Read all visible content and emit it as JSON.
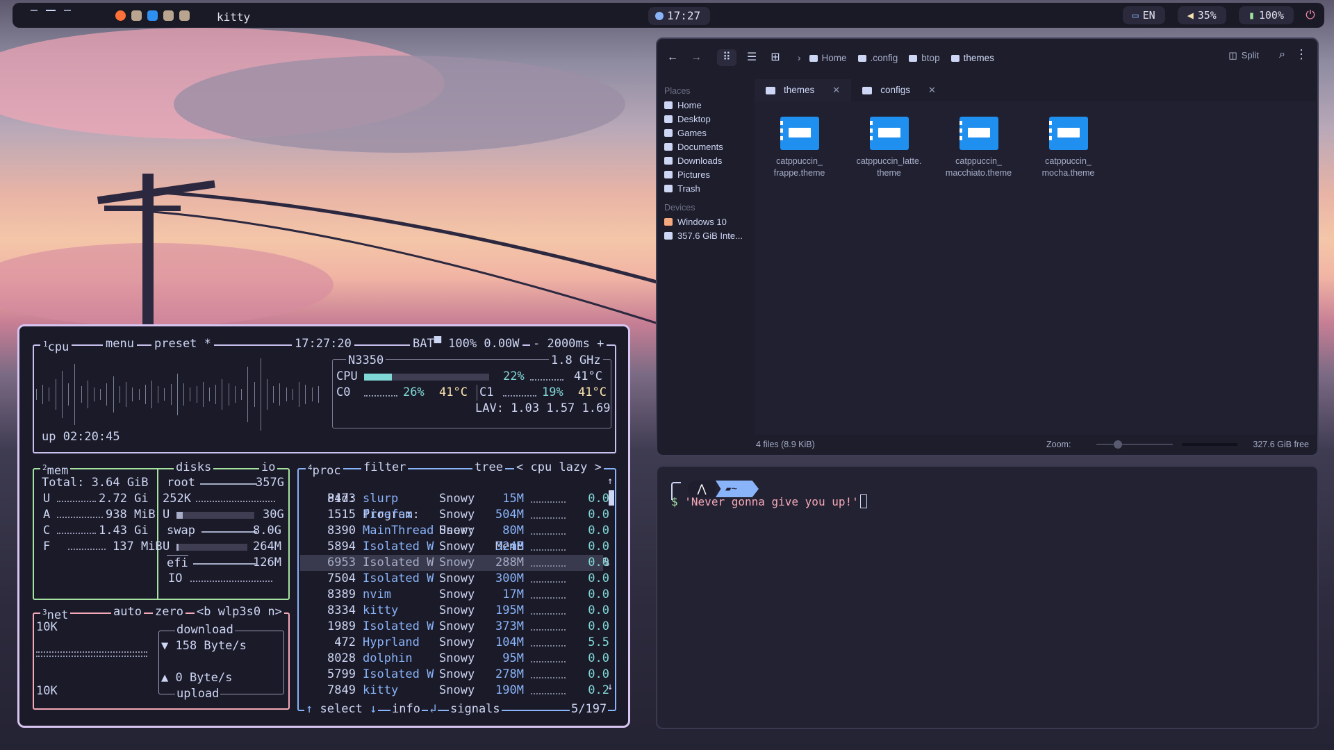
{
  "topbar": {
    "window_title": "kitty",
    "clock": "17:27",
    "language": "EN",
    "volume": "35%",
    "battery": "100%",
    "volume_icon": "speaker-icon",
    "battery_icon": "battery-icon",
    "power_icon": "power-icon"
  },
  "file_manager": {
    "breadcrumb": [
      "Home",
      ".config",
      "btop",
      "themes"
    ],
    "split_label": "Split",
    "places_heading": "Places",
    "places": [
      "Home",
      "Desktop",
      "Games",
      "Documents",
      "Downloads",
      "Pictures",
      "Trash"
    ],
    "devices_heading": "Devices",
    "devices": [
      "Windows 10",
      "357.6 GiB Inte..."
    ],
    "tabs": [
      "themes",
      "configs"
    ],
    "files": [
      {
        "line1": "catppuccin_",
        "line2": "frappe.theme"
      },
      {
        "line1": "catppuccin_latte.",
        "line2": "theme"
      },
      {
        "line1": "catppuccin_",
        "line2": "macchiato.theme"
      },
      {
        "line1": "catppuccin_",
        "line2": "mocha.theme"
      }
    ],
    "status_count": "4 files (8.9 KiB)",
    "zoom_label": "Zoom:",
    "zoom_level": 0.25,
    "free_space": "327.6 GiB free",
    "accent_color": "#1f8ff0"
  },
  "terminal": {
    "prompt_dir": "~",
    "prompt_symbol": "$",
    "command": "'Never gonna give you up!'"
  },
  "btop": {
    "cpu": {
      "header": "cpu",
      "header_num": "1",
      "menu": "menu",
      "preset": "preset *",
      "time": "17:27:20",
      "battery": "BAT▀ 100% 0.00W",
      "interval": "- 2000ms +",
      "model": "N3350",
      "freq": "1.8 GHz",
      "cpu_label": "CPU",
      "cpu_pct": "22%",
      "cpu_pct_value": 22,
      "cpu_temp": "41°C",
      "c0_label": "C0",
      "c0_pct": "26%",
      "c0_temp": "41°C",
      "c1_label": "C1",
      "c1_pct": "19%",
      "c1_temp": "41°C",
      "lav": "LAV: 1.03 1.57 1.69",
      "uptime": "up 02:20:45"
    },
    "mem": {
      "header": "mem",
      "header_num": "2",
      "total": "Total: 3.64 GiB",
      "rows": [
        {
          "k": "U",
          "v": "2.72 Gi"
        },
        {
          "k": "A",
          "v": "938 MiB"
        },
        {
          "k": "C",
          "v": "1.43 Gi"
        },
        {
          "k": "F",
          "v": "137 MiB"
        }
      ]
    },
    "disks": {
      "header": "disks",
      "io_label": "io",
      "root_label": "root",
      "root_size": "357G",
      "root_used": "252K",
      "u_label": "U",
      "root_u": "30G",
      "root_u_fraction": 0.08,
      "swap_label": "swap",
      "swap_size": "8.0G",
      "swap_u": "264M",
      "swap_u_fraction": 0.03,
      "efi_label": "efi",
      "efi_size": "126M",
      "io_row": "IO"
    },
    "net": {
      "header": "net",
      "header_num": "3",
      "auto": "auto",
      "zero": "zero",
      "iface": "<b wlp3s0 n>",
      "scale_top": "10K",
      "scale_bottom": "10K",
      "download_label": "download",
      "download_rate": "▼ 158 Byte/s",
      "upload_rate": "▲ 0 Byte/s",
      "upload_label": "upload"
    },
    "proc": {
      "header": "proc",
      "header_num": "4",
      "filter": "filter",
      "tree": "tree",
      "sort": "< cpu lazy >",
      "columns": {
        "pid": "Pid:",
        "program": "Program:",
        "user": "User:",
        "mem": "MemB",
        "cpu": "Cpu%"
      },
      "rows": [
        {
          "pid": "8473",
          "program": "slurp",
          "user": "Snowy",
          "mem": "15M",
          "cpu": "0.0"
        },
        {
          "pid": "1515",
          "program": "firefox",
          "user": "Snowy",
          "mem": "504M",
          "cpu": "0.0"
        },
        {
          "pid": "8390",
          "program": "MainThread",
          "user": "Snowy",
          "mem": "80M",
          "cpu": "0.0"
        },
        {
          "pid": "5894",
          "program": "Isolated W",
          "user": "Snowy",
          "mem": "324M",
          "cpu": "0.0"
        },
        {
          "pid": "6953",
          "program": "Isolated W",
          "user": "Snowy",
          "mem": "288M",
          "cpu": "0.0"
        },
        {
          "pid": "7504",
          "program": "Isolated W",
          "user": "Snowy",
          "mem": "300M",
          "cpu": "0.0"
        },
        {
          "pid": "8389",
          "program": "nvim",
          "user": "Snowy",
          "mem": "17M",
          "cpu": "0.0"
        },
        {
          "pid": "8334",
          "program": "kitty",
          "user": "Snowy",
          "mem": "195M",
          "cpu": "0.0"
        },
        {
          "pid": "1989",
          "program": "Isolated W",
          "user": "Snowy",
          "mem": "373M",
          "cpu": "0.0"
        },
        {
          "pid": "472",
          "program": "Hyprland",
          "user": "Snowy",
          "mem": "104M",
          "cpu": "5.5"
        },
        {
          "pid": "8028",
          "program": "dolphin",
          "user": "Snowy",
          "mem": "95M",
          "cpu": "0.0"
        },
        {
          "pid": "5799",
          "program": "Isolated W",
          "user": "Snowy",
          "mem": "278M",
          "cpu": "0.0"
        },
        {
          "pid": "7849",
          "program": "kitty",
          "user": "Snowy",
          "mem": "190M",
          "cpu": "0.2"
        }
      ],
      "select": "select",
      "info": "info",
      "signals": "signals",
      "count": "5/197"
    }
  }
}
